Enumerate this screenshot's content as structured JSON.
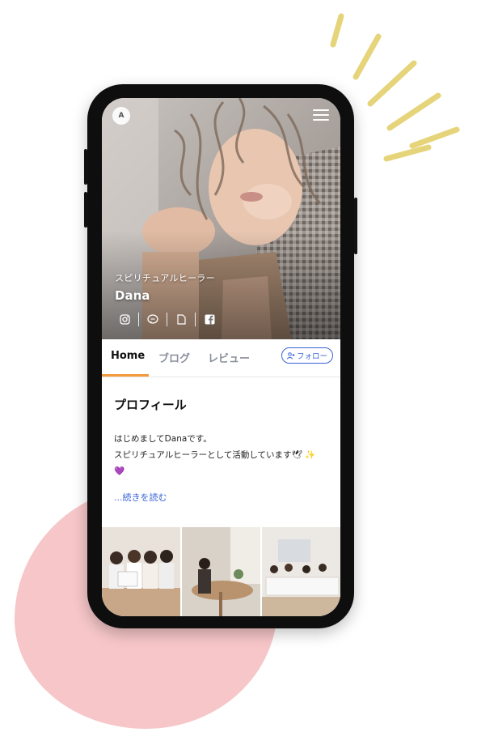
{
  "app": {
    "logo_text": "A",
    "menu_icon": "hamburger-menu-icon"
  },
  "profile": {
    "subtitle": "スピリチュアルヒーラー",
    "name": "Dana",
    "social_icons": [
      "instagram-icon",
      "line-icon",
      "document-icon",
      "facebook-icon"
    ]
  },
  "tabs": [
    {
      "label": "Home",
      "active": true
    },
    {
      "label": "ブログ",
      "active": false
    },
    {
      "label": "レビュー",
      "active": false
    }
  ],
  "follow_button": {
    "label": "フォロー",
    "icon": "add-person-icon"
  },
  "section": {
    "title": "プロフィール",
    "bio_line1": "はじめましてDanaです。",
    "bio_line2": "スピリチュアルヒーラーとして活動しています🕊 ✨",
    "bio_line3": "💜",
    "read_more": "...続きを読む"
  },
  "colors": {
    "accent": "#f39a3d",
    "link": "#3a63d9",
    "blob": "#f6c6c8",
    "sunburst": "#e6d47a"
  }
}
